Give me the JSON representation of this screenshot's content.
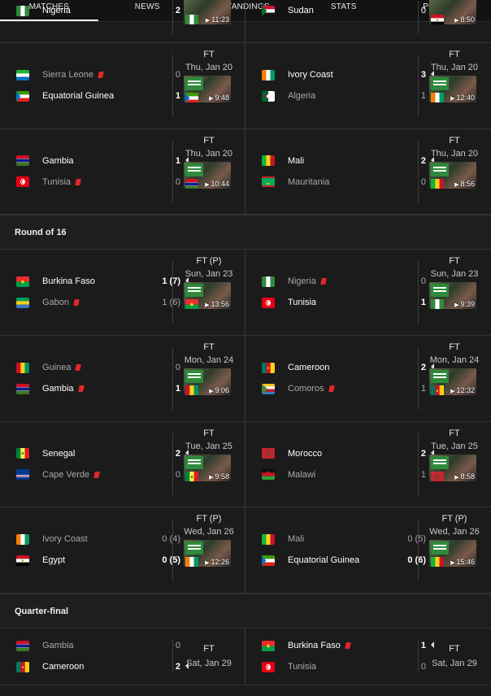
{
  "tabs": [
    "MATCHES",
    "NEWS",
    "STANDINGS",
    "STATS",
    "PLAYERS"
  ],
  "rows": [
    {
      "type": "match-row",
      "height": 52,
      "offset": -27,
      "cells": [
        {
          "home": {
            "name": "Nigeria",
            "score": "2",
            "flag": "nga",
            "win": true
          },
          "away": {
            "name": "Sudan",
            "score": "0",
            "flag": "sdn"
          },
          "time": "11:23",
          "thumbFlag": "nga",
          "partial": true
        },
        {
          "home": {
            "name": "Sudan",
            "score": "0",
            "flag": "sdn",
            "single": true
          },
          "time": "8:50",
          "thumbFlag": "egy",
          "partial": true
        }
      ]
    },
    {
      "type": "match-row",
      "height": 106,
      "cells": [
        {
          "home": {
            "name": "Sierra Leone",
            "score": "0",
            "flag": "sle",
            "card": true,
            "loser": true
          },
          "away": {
            "name": "Equatorial Guinea",
            "score": "1",
            "flag": "gnq",
            "win": true
          },
          "status": "FT",
          "date": "Thu, Jan 20",
          "time": "9:48",
          "thumbFlag": "gnq"
        },
        {
          "home": {
            "name": "Ivory Coast",
            "score": "3",
            "flag": "civ",
            "win": true
          },
          "away": {
            "name": "Algeria",
            "score": "1",
            "flag": "dza",
            "loser": true
          },
          "status": "FT",
          "date": "Thu, Jan 20",
          "time": "12:40",
          "thumbFlag": "civ"
        }
      ]
    },
    {
      "type": "match-row",
      "height": 105,
      "cells": [
        {
          "home": {
            "name": "Gambia",
            "score": "1",
            "flag": "gmb",
            "win": true
          },
          "away": {
            "name": "Tunisia",
            "score": "0",
            "flag": "tun",
            "card": true,
            "loser": true
          },
          "status": "FT",
          "date": "Thu, Jan 20",
          "time": "10:44",
          "thumbFlag": "gmb"
        },
        {
          "home": {
            "name": "Mali",
            "score": "2",
            "flag": "mli",
            "win": true
          },
          "away": {
            "name": "Mauritania",
            "score": "0",
            "flag": "mrt",
            "loser": true
          },
          "status": "FT",
          "date": "Thu, Jan 20",
          "time": "8:56",
          "thumbFlag": "mli"
        }
      ]
    },
    {
      "type": "section",
      "title": "Round of 16"
    },
    {
      "type": "match-row",
      "height": 106,
      "cells": [
        {
          "home": {
            "name": "Burkina Faso",
            "score": "1 (7)",
            "flag": "bfa",
            "win": true
          },
          "away": {
            "name": "Gabon",
            "score": "1 (6)",
            "flag": "gab",
            "card": true,
            "loser": true
          },
          "status": "FT (P)",
          "date": "Sun, Jan 23",
          "time": "13:56",
          "thumbFlag": "bfa"
        },
        {
          "home": {
            "name": "Nigeria",
            "score": "0",
            "flag": "nga",
            "card": true,
            "loser": true
          },
          "away": {
            "name": "Tunisia",
            "score": "1",
            "flag": "tun",
            "win": true
          },
          "status": "FT",
          "date": "Sun, Jan 23",
          "time": "9:39",
          "thumbFlag": "nga"
        }
      ]
    },
    {
      "type": "match-row",
      "height": 106,
      "cells": [
        {
          "home": {
            "name": "Guinea",
            "score": "0",
            "flag": "gin",
            "card": true,
            "loser": true
          },
          "away": {
            "name": "Gambia",
            "score": "1",
            "flag": "gmb",
            "card": true,
            "win": true
          },
          "status": "FT",
          "date": "Mon, Jan 24",
          "time": "9:06",
          "thumbFlag": "gin"
        },
        {
          "home": {
            "name": "Cameroon",
            "score": "2",
            "flag": "cmr",
            "win": true
          },
          "away": {
            "name": "Comoros",
            "score": "1",
            "flag": "com",
            "card": true,
            "loser": true
          },
          "status": "FT",
          "date": "Mon, Jan 24",
          "time": "12:32",
          "thumbFlag": "cmr"
        }
      ]
    },
    {
      "type": "match-row",
      "height": 105,
      "cells": [
        {
          "home": {
            "name": "Senegal",
            "score": "2",
            "flag": "sen",
            "win": true
          },
          "away": {
            "name": "Cape Verde",
            "score": "0",
            "flag": "cpv",
            "card": true,
            "loser": true
          },
          "status": "FT",
          "date": "Tue, Jan 25",
          "time": "9:58",
          "thumbFlag": "sen"
        },
        {
          "home": {
            "name": "Morocco",
            "score": "2",
            "flag": "mar",
            "win": true
          },
          "away": {
            "name": "Malawi",
            "score": "1",
            "flag": "mwi",
            "loser": true
          },
          "status": "FT",
          "date": "Tue, Jan 25",
          "time": "8:58",
          "thumbFlag": "mar"
        }
      ]
    },
    {
      "type": "match-row",
      "height": 106,
      "cells": [
        {
          "home": {
            "name": "Ivory Coast",
            "score": "0 (4)",
            "flag": "civ",
            "loser": true
          },
          "away": {
            "name": "Egypt",
            "score": "0 (5)",
            "flag": "egy",
            "win": true
          },
          "status": "FT (P)",
          "date": "Wed, Jan 26",
          "time": "12:26",
          "thumbFlag": "civ"
        },
        {
          "home": {
            "name": "Mali",
            "score": "0 (5)",
            "flag": "mli",
            "loser": true
          },
          "away": {
            "name": "Equatorial Guinea",
            "score": "0 (6)",
            "flag": "gnq",
            "win": true
          },
          "status": "FT (P)",
          "date": "Wed, Jan 26",
          "time": "15:46",
          "thumbFlag": "mli"
        }
      ]
    },
    {
      "type": "section",
      "title": "Quarter-final"
    },
    {
      "type": "match-row",
      "height": 70,
      "cells": [
        {
          "home": {
            "name": "Gambia",
            "score": "0",
            "flag": "gmb",
            "loser": true
          },
          "away": {
            "name": "Cameroon",
            "score": "2",
            "flag": "cmr",
            "win": true
          },
          "status": "FT",
          "date": "Sat, Jan 29",
          "noThumb": true
        },
        {
          "home": {
            "name": "Burkina Faso",
            "score": "1",
            "flag": "bfa",
            "card": true,
            "win": true
          },
          "away": {
            "name": "Tunisia",
            "score": "0",
            "flag": "tun",
            "loser": true
          },
          "status": "FT",
          "date": "Sat, Jan 29",
          "noThumb": true
        }
      ]
    }
  ],
  "colors": {
    "background": "#1b1b1c",
    "redCard": "#e02828"
  }
}
